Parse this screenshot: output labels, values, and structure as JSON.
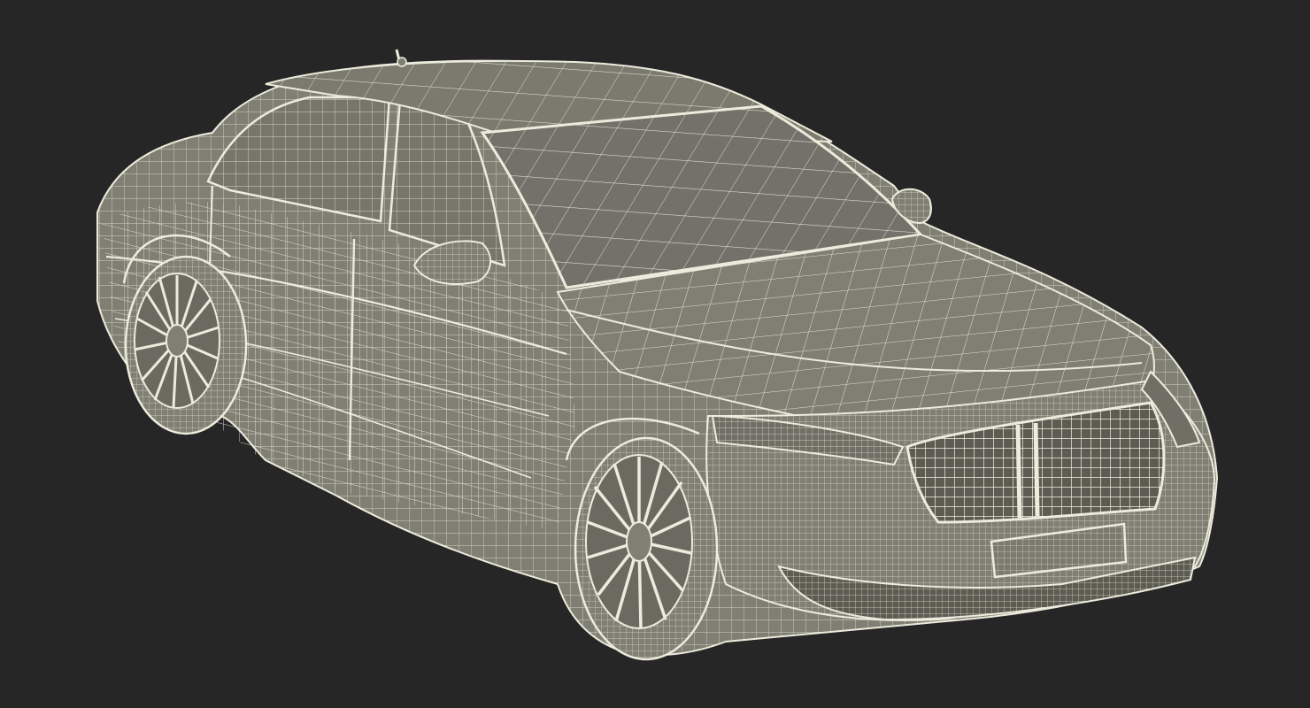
{
  "scene": {
    "background_color": "#262626",
    "model_surface_color": "#7f7f74",
    "model_surface_shadow_color": "#5c5c52",
    "wire_color": "#ecebdc",
    "render_style": "wireframe-over-shaded",
    "subject_icon": "sedan-car-wireframe"
  }
}
